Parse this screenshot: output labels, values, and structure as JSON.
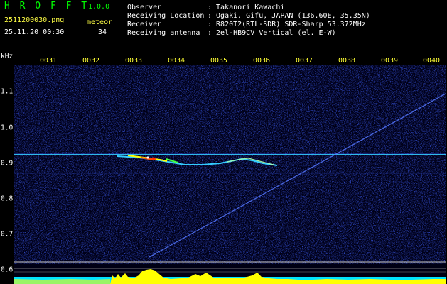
{
  "header": {
    "app_name": "H R O F F T",
    "version": "1.0.0",
    "filename": "2511200030.png",
    "datetime": "25.11.20 00:30",
    "meteor_label": "meteor",
    "meteor_count": "34"
  },
  "info": {
    "observer_label": "Observer",
    "observer_value": ": Takanori Kawachi",
    "location_label": "Receiving Location",
    "location_value": ": Ogaki, Gifu, JAPAN (136.60E, 35.35N)",
    "receiver_label": "Receiver",
    "receiver_value": ": R820T2(RTL-SDR) SDR-Sharp 53.372MHz",
    "antenna_label": "Receiving antenna",
    "antenna_value": ": 2el-HB9CV Vertical (el. E-W)"
  },
  "axes": {
    "y_unit": "kHz",
    "x_ticks": [
      "0031",
      "0032",
      "0033",
      "0034",
      "0035",
      "0036",
      "0037",
      "0038",
      "0039",
      "0040"
    ],
    "y_ticks": [
      "1.1",
      "1.0",
      "0.9",
      "0.8",
      "0.7",
      "0.6"
    ]
  },
  "colors": {
    "background": "#000000",
    "header_green": "#00ff00",
    "tick_yellow": "#ffff33",
    "noise_blue": "#1a2aff",
    "carrier_cyan": "#33ccff",
    "meteor_echo": "#ffff00",
    "bottom_bar_cyan": "#00e5ff",
    "bottom_bar_yellow": "#ffff00"
  }
}
